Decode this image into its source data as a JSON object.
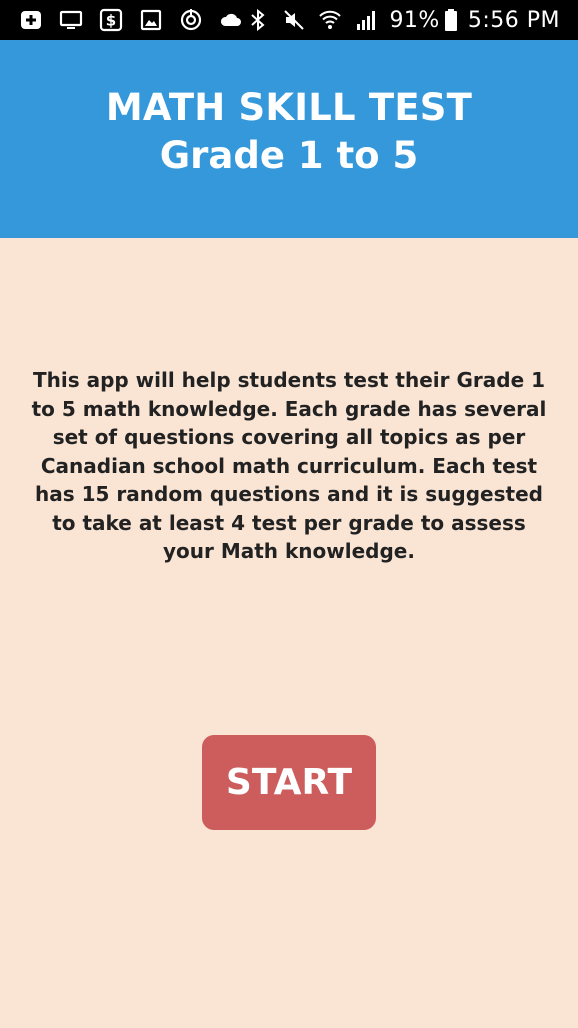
{
  "status_bar": {
    "icons_left": [
      "add-box-icon",
      "monitor-icon",
      "dollar-icon",
      "image-icon",
      "sync-icon",
      "cloud-icon"
    ],
    "icons_right": [
      "bluetooth-icon",
      "mute-icon",
      "wifi-icon",
      "signal-icon"
    ],
    "battery_text": "91%",
    "time": "5:56 PM"
  },
  "header": {
    "title": "MATH SKILL TEST",
    "subtitle": "Grade 1 to 5"
  },
  "main": {
    "description": "This app will help students test their Grade 1 to 5 math knowledge. Each grade has several set of questions covering all topics as per Canadian school math curriculum. Each test has 15 random questions and it is suggested to take at least 4 test per grade to assess your Math knowledge."
  },
  "actions": {
    "start_label": "START"
  },
  "colors": {
    "header_bg": "#3498db",
    "page_bg": "#fae5d5",
    "start_button_bg": "#cd5c5c"
  }
}
